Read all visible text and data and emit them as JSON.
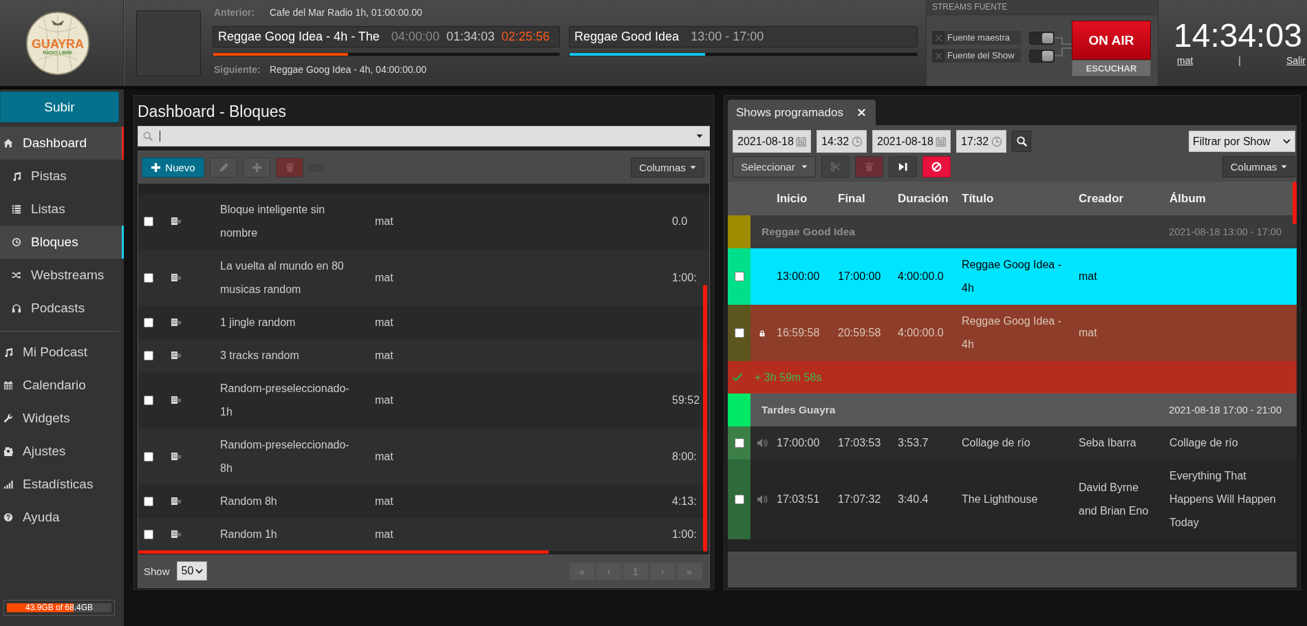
{
  "header": {
    "logo": {
      "name": "GUAYRA",
      "tagline": "RADIO LIBRE"
    },
    "previous": {
      "label": "Anterior:",
      "text": "Cafe del Mar Radio 1h, 01:00:00.00"
    },
    "current_track": {
      "title": "Reggae Goog Idea - 4h - The",
      "length": "04:00:00",
      "elapsed": "01:34:03",
      "remaining": "02:25:56",
      "level": 0.39
    },
    "current_show": {
      "title": "Reggae Good Idea",
      "time": "13:00 - 17:00",
      "level": 0.39
    },
    "next": {
      "label": "Siguiente:",
      "text": "Reggae Goog Idea - 4h, 04:00:00.00"
    }
  },
  "streams": {
    "title": "STREAMS FUENTE",
    "sources": [
      {
        "label": "Fuente maestra",
        "disabled": true
      },
      {
        "label": "Fuente del Show",
        "disabled": true
      }
    ],
    "on_air": {
      "label": "ON AIR",
      "on": true
    },
    "listen": "ESCUCHAR"
  },
  "clock": {
    "time": "14:34:03",
    "user": "mat",
    "separator": "|",
    "logout": "Salir"
  },
  "sidebar": {
    "upload": "Subir",
    "items": [
      {
        "label": "Dashboard",
        "selected": true,
        "children": [
          {
            "label": "Pistas",
            "selected": false
          },
          {
            "label": "Listas",
            "selected": false
          },
          {
            "label": "Bloques",
            "selected": true
          },
          {
            "label": "Webstreams",
            "selected": false
          },
          {
            "label": "Podcasts",
            "selected": false
          }
        ]
      },
      {
        "label": "Mi Podcast",
        "selected": false
      },
      {
        "label": "Calendario",
        "selected": false
      },
      {
        "label": "Widgets",
        "selected": false
      },
      {
        "label": "Ajustes",
        "selected": false
      },
      {
        "label": "Estadísticas",
        "selected": false
      },
      {
        "label": "Ayuda",
        "selected": false
      }
    ],
    "storage": {
      "text": "43.9GB of 68.4GB",
      "level": 0.64
    }
  },
  "library": {
    "title": "Dashboard - Bloques",
    "toolbar": [
      {
        "kind": "new",
        "label": "Nuevo",
        "disabled": false
      },
      {
        "kind": "edit",
        "disabled": true
      },
      {
        "kind": "add",
        "disabled": true
      },
      {
        "kind": "delete",
        "disabled": true
      },
      {
        "kind": "blank",
        "disabled": true
      }
    ],
    "columns_button": "Columnas",
    "rows": [
      {
        "checked": false,
        "title": "Bloque inteligente sin nombre",
        "creator": "mat",
        "length": "0.0"
      },
      {
        "checked": false,
        "title": "La vuelta al mundo en 80 musicas random",
        "creator": "mat",
        "length": "1:00:"
      },
      {
        "checked": false,
        "title": "1 jingle random",
        "creator": "mat"
      },
      {
        "checked": false,
        "title": "3 tracks random",
        "creator": "mat"
      },
      {
        "checked": false,
        "title": "Random-preseleccionado-1h",
        "creator": "mat",
        "length": "59:52"
      },
      {
        "checked": false,
        "title": "Random-preseleccionado-8h",
        "creator": "mat",
        "length": "8:00:"
      },
      {
        "checked": false,
        "title": "Random 8h",
        "creator": "mat",
        "length": "4:13:"
      },
      {
        "checked": false,
        "title": "Random 1h",
        "creator": "mat",
        "length": "1:00:"
      }
    ],
    "footer": {
      "show_label": "Show",
      "page_size": "50",
      "pages": [
        "«",
        "‹",
        "1",
        "›",
        "»"
      ]
    }
  },
  "schedule": {
    "tab": "Shows programados",
    "filters": {
      "start_date": "2021-08-18",
      "start_time": "14:32",
      "end_date": "2021-08-18",
      "end_time": "17:32",
      "show_filter": "Filtrar por Show"
    },
    "select_button": "Seleccionar",
    "tools": [
      {
        "kind": "cut",
        "disabled": true
      },
      {
        "kind": "delete",
        "disabled": true
      },
      {
        "kind": "skip",
        "disabled": false
      },
      {
        "kind": "cancel",
        "disabled": false
      }
    ],
    "columns_button": "Columnas",
    "columns": [
      "Inicio",
      "Final",
      "Duración",
      "Título",
      "Creador",
      "Álbum"
    ],
    "rows": [
      {
        "kind": "show",
        "dimmed": true,
        "name": "Reggae Good Idea",
        "time": "2021-08-18 13:00 - 17:00",
        "color": "#a08c00"
      },
      {
        "kind": "track",
        "playing": true,
        "overbooked": false,
        "checked": false,
        "start": "13:00:00",
        "end": "17:00:00",
        "length": "4:00:00.0",
        "title": "Reggae Goog Idea - 4h",
        "creator": "mat",
        "color": "#00e08a"
      },
      {
        "kind": "track",
        "playing": false,
        "overbooked": true,
        "checked": false,
        "start": "16:59:58",
        "end": "20:59:58",
        "length": "4:00:00.0",
        "title": "Reggae Goog Idea - 4h",
        "creator": "mat",
        "color": "#5c561e"
      },
      {
        "kind": "gap",
        "text": "+ 3h 59m 58s"
      },
      {
        "kind": "show",
        "dimmed": false,
        "name": "Tardes Guayra",
        "time": "2021-08-18 17:00 - 21:00",
        "color": "#00e866"
      },
      {
        "kind": "track",
        "playing": false,
        "overbooked": false,
        "checked": false,
        "start": "17:00:00",
        "end": "17:03:53",
        "length": "3:53.7",
        "title": "Collage de río",
        "creator": "Seba Ibarra",
        "album": "Collage de río",
        "color": "#3b7f47"
      },
      {
        "kind": "track",
        "playing": false,
        "overbooked": false,
        "checked": false,
        "start": "17:03:51",
        "end": "17:07:32",
        "length": "3:40.4",
        "title": "The Lighthouse",
        "creator": "David Byrne and Brian Eno",
        "album": "Everything That Happens Will Happen Today",
        "color": "#2f6a3a"
      }
    ]
  }
}
